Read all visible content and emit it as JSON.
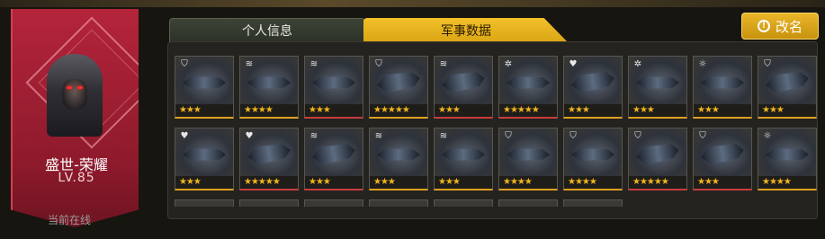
{
  "profile": {
    "name": "盛世-荣耀",
    "level": "LV.85",
    "status": "当前在线"
  },
  "tabs": [
    {
      "label": "个人信息",
      "active": false
    },
    {
      "label": "军事数据",
      "active": true
    }
  ],
  "rename_button": {
    "label": "改名"
  },
  "colors": {
    "accent": "#f2c12a",
    "profile_bg": "#b4243a",
    "star": "#f1b51c"
  },
  "cards_row1": [
    {
      "icon": "shield-icon",
      "stars": "★★★"
    },
    {
      "icon": "wing-icon",
      "stars": "★★★★"
    },
    {
      "icon": "wing-icon",
      "stars": "★★★"
    },
    {
      "icon": "shield-icon",
      "stars": "★★★★★"
    },
    {
      "icon": "wing-icon",
      "stars": "★★★"
    },
    {
      "icon": "gear-icon",
      "stars": "★★★★★"
    },
    {
      "icon": "heart-icon",
      "stars": "★★★"
    },
    {
      "icon": "gear-icon",
      "stars": "★★★"
    },
    {
      "icon": "sun-icon",
      "stars": "★★★"
    },
    {
      "icon": "shield-icon",
      "stars": "★★★"
    }
  ],
  "cards_row2": [
    {
      "icon": "heart-icon",
      "stars": "★★★"
    },
    {
      "icon": "heart-icon",
      "stars": "★★★★★"
    },
    {
      "icon": "wing-icon",
      "stars": "★★★"
    },
    {
      "icon": "wing-icon",
      "stars": "★★★"
    },
    {
      "icon": "wing-icon",
      "stars": "★★★"
    },
    {
      "icon": "shield-icon",
      "stars": "★★★★"
    },
    {
      "icon": "shield-icon",
      "stars": "★★★★"
    },
    {
      "icon": "shield-icon",
      "stars": "★★★★★"
    },
    {
      "icon": "shield-icon",
      "stars": "★★★"
    },
    {
      "icon": "sun-icon",
      "stars": "★★★★"
    }
  ]
}
